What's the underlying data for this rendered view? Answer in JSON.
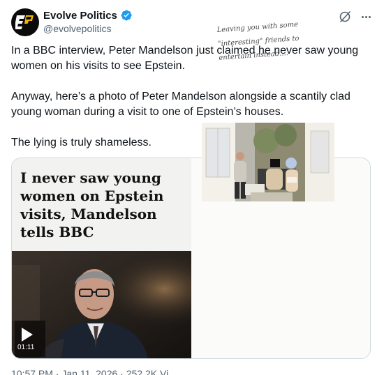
{
  "author": {
    "display_name": "Evolve Politics",
    "handle": "@evolvepolitics",
    "verified": true,
    "avatar_icon": "evolve-politics-logo",
    "avatar_bg": "#0b0b0b",
    "avatar_accent": "#f2b705"
  },
  "actions": {
    "grok_icon": "grok-icon",
    "more_icon": "more-icon"
  },
  "tweet": {
    "paragraphs": [
      "In a BBC interview, Peter Mandelson just claimed he never saw young women on his visits to see Epstein.",
      "Anyway, here’s a photo of Peter Mandelson alongside a scantily clad young woman during a visit to one of Epstein’s houses.",
      "The lying is truly shameless."
    ]
  },
  "media": {
    "headline": "I never saw young women on Epstein visits, Mandelson tells BBC",
    "video": {
      "play_icon": "play-icon",
      "duration": "01:11"
    },
    "handwritten_note": [
      "Leaving you with some",
      "\"interesting\" friends to",
      "entertain instead...."
    ]
  },
  "footer": {
    "timestamp_partial": "10:57 PM · Jan 11, 2026 · 252.2K Vi"
  },
  "colors": {
    "verified_blue": "#1d9bf0",
    "text_primary": "#0f1419",
    "text_secondary": "#536471",
    "border": "#cfd9de"
  }
}
